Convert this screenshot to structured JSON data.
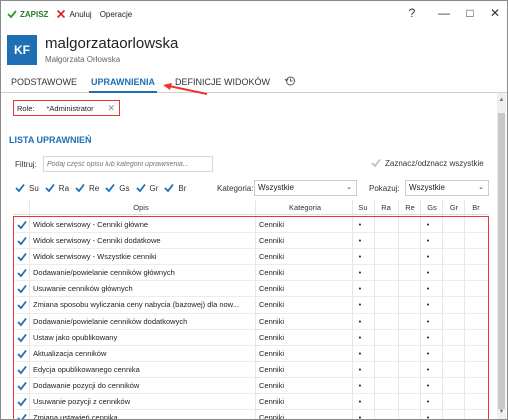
{
  "toolbar": {
    "save_label": "ZAPISZ",
    "cancel_label": "Anuluj",
    "operations_label": "Operacje"
  },
  "window_controls": {
    "help": "?",
    "minimize": "—",
    "maximize": "□",
    "close": "✕"
  },
  "user": {
    "initials": "KF",
    "login": "malgorzataorlowska",
    "full_name": "Małgorzata Orłowska"
  },
  "tabs": [
    {
      "label": "PODSTAWOWE"
    },
    {
      "label": "UPRAWNIENIA"
    },
    {
      "label": "DEFINICJE WIDOKÓW"
    }
  ],
  "roles": {
    "label": "Role:",
    "value": "*Administrator"
  },
  "section_title": "LISTA UPRAWNIEŃ",
  "filter": {
    "label": "Filtruj:",
    "placeholder": "Podaj część opisu lub kategorii uprawnienia...",
    "select_all_label": "Zaznacz/odznacz wszystkie"
  },
  "types": [
    {
      "label": "Su",
      "checked": true
    },
    {
      "label": "Ra",
      "checked": true
    },
    {
      "label": "Re",
      "checked": true
    },
    {
      "label": "Gs",
      "checked": true
    },
    {
      "label": "Gr",
      "checked": true
    },
    {
      "label": "Br",
      "checked": true
    }
  ],
  "category_filter": {
    "label": "Kategoria:",
    "value": "Wszystkie"
  },
  "show_filter": {
    "label": "Pokazuj:",
    "value": "Wszystkie"
  },
  "table": {
    "columns": [
      "Opis",
      "Kategoria",
      "Su",
      "Ra",
      "Re",
      "Gs",
      "Gr",
      "Br"
    ],
    "rows": [
      {
        "desc": "Widok serwisowy - Cenniki główne",
        "cat": "Cenniki",
        "su": "•",
        "gs": "•"
      },
      {
        "desc": "Widok serwisowy - Cenniki dodatkowe",
        "cat": "Cenniki",
        "su": "•",
        "gs": "•"
      },
      {
        "desc": "Widok serwisowy - Wszystkie cenniki",
        "cat": "Cenniki",
        "su": "•",
        "gs": "•"
      },
      {
        "desc": "Dodawanie/powielanie cenników głównych",
        "cat": "Cenniki",
        "su": "•",
        "gs": "•"
      },
      {
        "desc": "Usuwanie cenników głównych",
        "cat": "Cenniki",
        "su": "•",
        "gs": "•"
      },
      {
        "desc": "Zmiana sposobu wyliczania ceny nabycia (bazowej) dla now...",
        "cat": "Cenniki",
        "su": "•",
        "gs": "•"
      },
      {
        "desc": "Dodawanie/powielanie cenników dodatkowych",
        "cat": "Cenniki",
        "su": "•",
        "gs": "•"
      },
      {
        "desc": "Ustaw jako opublikowany",
        "cat": "Cenniki",
        "su": "•",
        "gs": "•"
      },
      {
        "desc": "Aktualizacja cenników",
        "cat": "Cenniki",
        "su": "•",
        "gs": "•"
      },
      {
        "desc": "Edycja opublikowanego cennika",
        "cat": "Cenniki",
        "su": "•",
        "gs": "•"
      },
      {
        "desc": "Dodawanie pozycji do cenników",
        "cat": "Cenniki",
        "su": "•",
        "gs": "•"
      },
      {
        "desc": "Usuwanie pozycji z cenników",
        "cat": "Cenniki",
        "su": "•",
        "gs": "•"
      },
      {
        "desc": "Zmiana ustawień cennika",
        "cat": "Cenniki",
        "su": "•",
        "gs": "•"
      }
    ]
  },
  "colors": {
    "accent": "#1f6fb5",
    "save": "#2a7a2a",
    "annotation": "#e33333"
  }
}
